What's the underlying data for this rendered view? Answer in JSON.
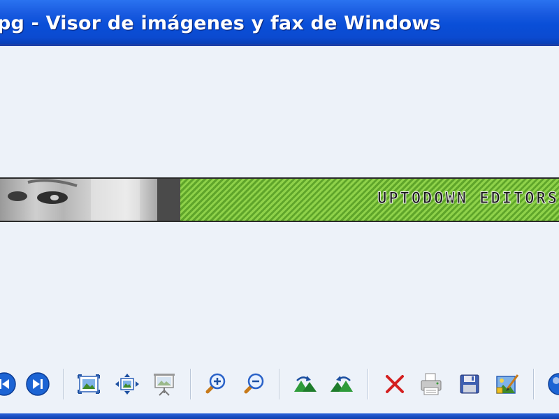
{
  "window": {
    "title": "pg - Visor de imágenes y fax de Windows"
  },
  "image": {
    "banner_text": "UPTODOWN EDITORS"
  },
  "toolbar": {
    "buttons": [
      {
        "name": "previous-image-button",
        "icon": "previous-arrow-icon"
      },
      {
        "name": "next-image-button",
        "icon": "next-arrow-icon"
      },
      {
        "name": "best-fit-button",
        "icon": "best-fit-icon"
      },
      {
        "name": "actual-size-button",
        "icon": "actual-size-icon"
      },
      {
        "name": "slideshow-button",
        "icon": "slideshow-icon"
      },
      {
        "name": "zoom-in-button",
        "icon": "zoom-in-icon"
      },
      {
        "name": "zoom-out-button",
        "icon": "zoom-out-icon"
      },
      {
        "name": "rotate-clockwise-button",
        "icon": "rotate-clockwise-icon"
      },
      {
        "name": "rotate-counterclockwise-button",
        "icon": "rotate-counterclockwise-icon"
      },
      {
        "name": "delete-button",
        "icon": "delete-icon"
      },
      {
        "name": "print-button",
        "icon": "print-icon"
      },
      {
        "name": "save-button",
        "icon": "save-icon"
      },
      {
        "name": "edit-button",
        "icon": "edit-image-icon"
      },
      {
        "name": "help-button",
        "icon": "help-icon"
      }
    ]
  },
  "colors": {
    "titlebar": "#0a4fd8",
    "viewer_background": "#edf2f9",
    "banner_green": "#8fd24a"
  }
}
